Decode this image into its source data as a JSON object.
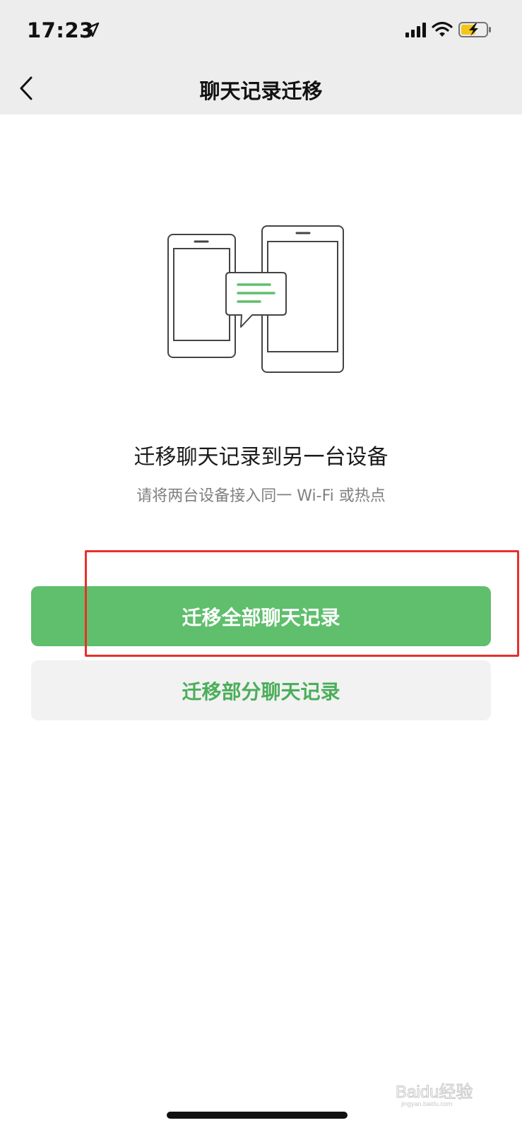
{
  "status_bar": {
    "time": "17:23",
    "icons": [
      "location-arrow-icon",
      "cellular-signal-icon",
      "wifi-icon",
      "battery-charging-icon"
    ]
  },
  "nav": {
    "title": "聊天记录迁移",
    "back_icon": "chevron-left-icon"
  },
  "illustration": {
    "icon": "phone-transfer-illustration",
    "accent_color": "#5fbf6c"
  },
  "content": {
    "headline": "迁移聊天记录到另一台设备",
    "subline": "请将两台设备接入同一 Wi-Fi 或热点"
  },
  "buttons": {
    "migrate_all": "迁移全部聊天记录",
    "migrate_partial": "迁移部分聊天记录"
  },
  "colors": {
    "primary_green": "#5fbf6c",
    "secondary_text_green": "#4bae5a",
    "highlight_red": "#e8302c",
    "bar_background": "#ededed"
  },
  "watermark": {
    "text": "Baidu经验",
    "subtext": "jingyan.baidu.com"
  }
}
